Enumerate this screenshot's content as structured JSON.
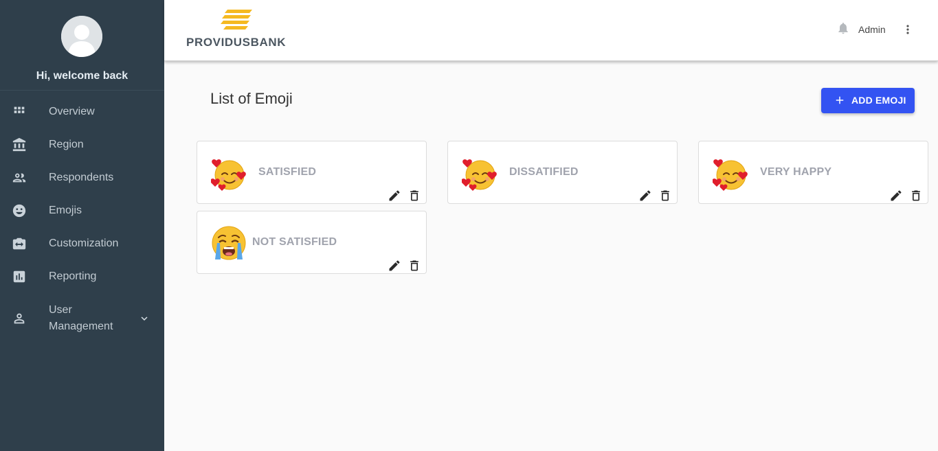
{
  "sidebar": {
    "welcome": "Hi, welcome back",
    "items": [
      {
        "label": "Overview",
        "icon": "grid-icon"
      },
      {
        "label": "Region",
        "icon": "bank-icon"
      },
      {
        "label": "Respondents",
        "icon": "people-icon"
      },
      {
        "label": "Emojis",
        "icon": "smiley-icon"
      },
      {
        "label": "Customization",
        "icon": "camera-icon"
      },
      {
        "label": "Reporting",
        "icon": "bar-chart-icon"
      },
      {
        "label_line1": "User",
        "label_line2": "Management",
        "icon": "user-icon",
        "expand_icon": "chevron-down-icon"
      }
    ]
  },
  "header": {
    "logo_text": "PROVIDUSBANK",
    "user_name": "Admin",
    "notification_icon": "bell-icon",
    "menu_icon": "more-vert-icon"
  },
  "main": {
    "title": "List of Emoji",
    "add_button_label": "ADD EMOJI",
    "emojis": [
      {
        "label": "SATISFIED",
        "icon": "smiling-face-with-hearts-emoji"
      },
      {
        "label": "DISSATIFIED",
        "icon": "smiling-face-with-hearts-emoji"
      },
      {
        "label": "VERY HAPPY",
        "icon": "smiling-face-with-hearts-emoji"
      },
      {
        "label": "NOT SATISFIED",
        "icon": "loudly-crying-face-emoji"
      }
    ]
  },
  "colors": {
    "sidebar_bg": "#2f3f4b",
    "accent": "#3353f2",
    "logo_gold": "#f5b921",
    "card_label": "#a0a3ad"
  }
}
